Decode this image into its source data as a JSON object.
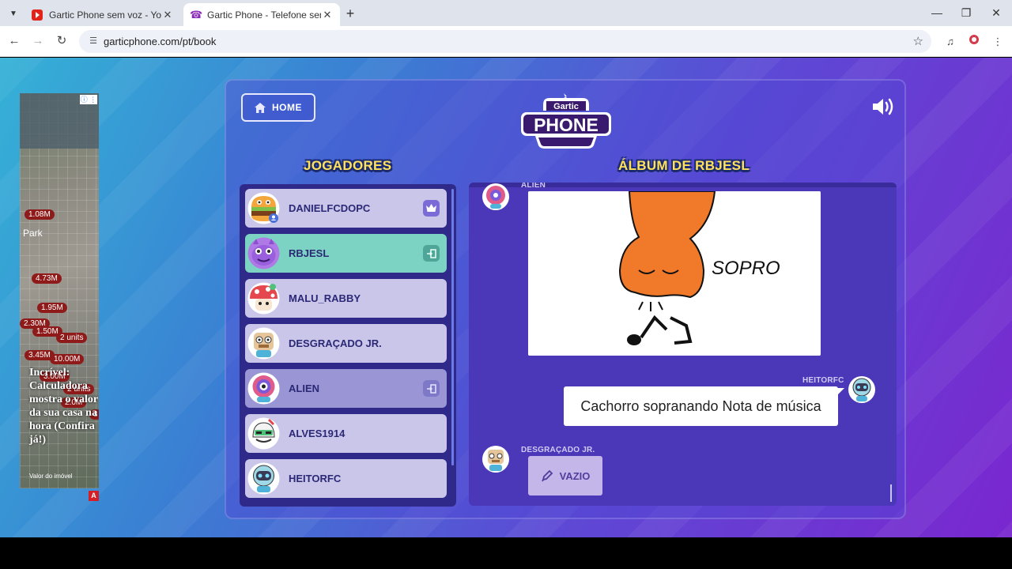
{
  "browser": {
    "tabs": [
      {
        "title": "Gartic Phone sem voz - YouTube",
        "favicon": "youtube-icon",
        "active": false
      },
      {
        "title": "Gartic Phone - Telefone sem fio",
        "favicon": "phone-icon",
        "active": true
      }
    ],
    "url": "garticphone.com/pt/book"
  },
  "ad": {
    "pins": [
      "1.08M",
      "4.73M",
      "1.95M",
      "2.30M",
      "1.50M",
      "2 units",
      "3.45M",
      "10.00M",
      "3.00M",
      "2.0M",
      "2 units",
      "8"
    ],
    "park_label": "Park",
    "headline": "Incrível: Calculadora mostra o valor da sua casa na hora (Confira já!)",
    "subline": "Valor do imóvel"
  },
  "header": {
    "home_label": "HOME",
    "logo_top": "Gartic",
    "logo_bottom": "PHONE"
  },
  "players": {
    "title": "JOGADORES",
    "list": [
      {
        "name": "DANIELFCDOPC",
        "badge": "crown-icon",
        "state": "normal"
      },
      {
        "name": "RBJESL",
        "badge": "exit-icon",
        "state": "active"
      },
      {
        "name": "MALU_RABBY",
        "badge": "",
        "state": "normal"
      },
      {
        "name": "DESGRAÇADO JR.",
        "badge": "",
        "state": "normal"
      },
      {
        "name": "ALIEN",
        "badge": "exit-icon",
        "state": "dim"
      },
      {
        "name": "ALVES1914",
        "badge": "",
        "state": "normal"
      },
      {
        "name": "HEITORFC",
        "badge": "",
        "state": "normal"
      }
    ]
  },
  "album": {
    "title": "ÁLBUM DE RBJESL",
    "messages": [
      {
        "author": "ALIEN",
        "type": "drawing",
        "drawing_text": "SOPRO"
      },
      {
        "author": "HEITORFC",
        "type": "text",
        "text": "Cachorro sopranando Nota de música"
      },
      {
        "author": "DESGRAÇADO JR.",
        "type": "empty",
        "text": "VAZIO"
      }
    ]
  },
  "colors": {
    "title_yellow": "#ffe25a",
    "active_player": "#7dd3c3",
    "panel_dark": "#2f2a8a"
  }
}
